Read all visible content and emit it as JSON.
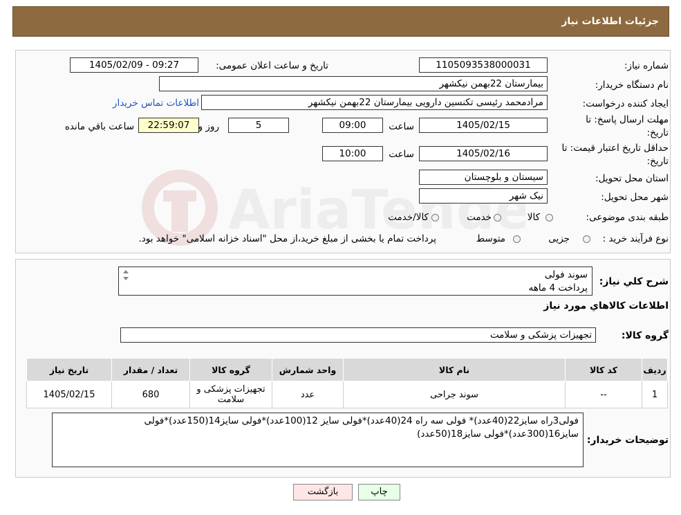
{
  "header": {
    "title": "جزئیات اطلاعات نیاز"
  },
  "fields": {
    "need_number_label": "شماره نیاز:",
    "need_number": "1105093538000031",
    "announce_label": "تاریخ و ساعت اعلان عمومی:",
    "announce_value": "1405/02/09 - 09:27",
    "buyer_org_label": "نام دستگاه خریدار:",
    "buyer_org": "بیمارستان 22بهمن نیکشهر",
    "creator_label": "ایجاد کننده درخواست:",
    "creator": "مرادمحمد رئیسی تکنسین دارویی بیمارستان 22بهمن نیکشهر",
    "contact_link": "اطلاعات تماس خریدار",
    "deadline_label": "مهلت ارسال پاسخ: تا تاریخ:",
    "deadline_date": "1405/02/15",
    "time_label": "ساعت",
    "deadline_time": "09:00",
    "days_value": "5",
    "days_label": "روز و",
    "remaining_time": "22:59:07",
    "remaining_label": "ساعت باقي مانده",
    "validity_label": "حداقل تاریخ اعتبار قیمت: تا تاریخ:",
    "validity_date": "1405/02/16",
    "validity_time": "10:00",
    "province_label": "استان محل تحویل:",
    "province": "سیستان و بلوچستان",
    "city_label": "شهر محل تحویل:",
    "city": "نیک شهر",
    "category_label": "طبقه بندی موضوعی:",
    "category_options": [
      "کالا",
      "خدمت",
      "کالا/خدمت"
    ],
    "process_label": "نوع فرآیند خرید :",
    "process_options": [
      "جزیی",
      "متوسط"
    ],
    "process_note": "پرداخت تمام یا بخشی از مبلغ خرید،از محل \"اسناد خزانه اسلامی\" خواهد بود."
  },
  "description": {
    "label": "شرح کلي نياز:",
    "lines": [
      "سوند فولی",
      "پرداخت 4 ماهه"
    ]
  },
  "goods_info": {
    "title": "اطلاعات کالاهاي مورد نياز",
    "group_label": "گروه کالا:",
    "group_value": "تجهیزات پزشکی و سلامت"
  },
  "table": {
    "headers": [
      "ردیف",
      "کد کالا",
      "نام کالا",
      "واحد شمارش",
      "گروه کالا",
      "تعداد / مقدار",
      "تاریخ نیاز"
    ],
    "rows": [
      [
        "1",
        "--",
        "سوند جراحی",
        "عدد",
        "تجهیزات پزشکی و سلامت",
        "680",
        "1405/02/15"
      ]
    ]
  },
  "buyer_notes": {
    "label": "توضیحات خریدار:",
    "text": "فولی3راه سایز22(40عدد)* فولی سه راه 24(40عدد)*فولی سایز 12(100عدد)*فولی سایز14(150عدد)*فولی سایز16(300عدد)*فولی سایز18(50عدد)"
  },
  "buttons": {
    "print": "چاپ",
    "back": "بازگشت"
  },
  "watermark": "AriaTender.neT"
}
